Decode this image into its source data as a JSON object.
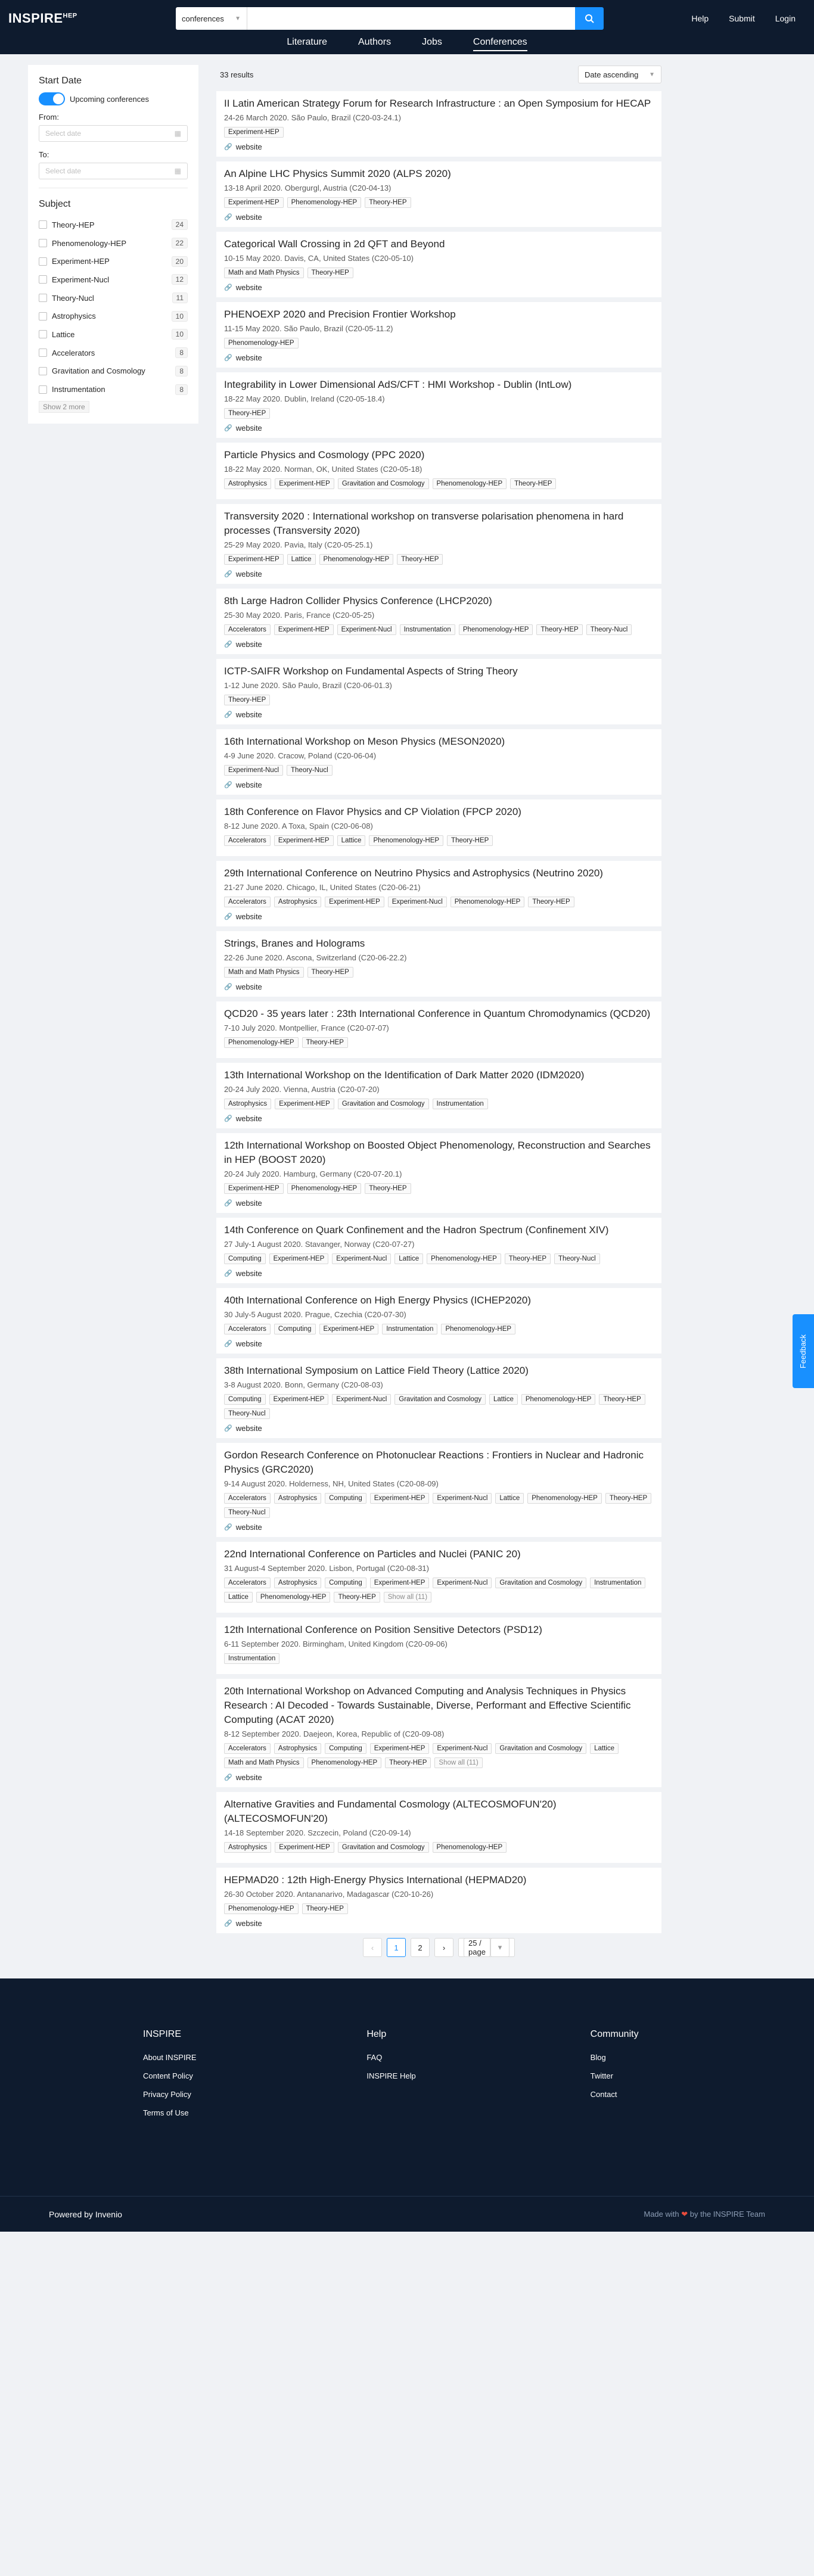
{
  "header": {
    "logo": "INSPIRE",
    "logo_sup": "HEP",
    "search_scope": "conferences",
    "search_value": "",
    "nav": [
      "Help",
      "Submit",
      "Login"
    ],
    "subnav": [
      "Literature",
      "Authors",
      "Jobs",
      "Conferences"
    ],
    "active_subnav": "Conferences"
  },
  "sidebar": {
    "start_date": "Start Date",
    "upcoming": "Upcoming conferences",
    "from": "From:",
    "to": "To:",
    "date_placeholder": "Select date",
    "subject": "Subject",
    "subjects": [
      {
        "label": "Theory-HEP",
        "count": "24"
      },
      {
        "label": "Phenomenology-HEP",
        "count": "22"
      },
      {
        "label": "Experiment-HEP",
        "count": "20"
      },
      {
        "label": "Experiment-Nucl",
        "count": "12"
      },
      {
        "label": "Theory-Nucl",
        "count": "11"
      },
      {
        "label": "Astrophysics",
        "count": "10"
      },
      {
        "label": "Lattice",
        "count": "10"
      },
      {
        "label": "Accelerators",
        "count": "8"
      },
      {
        "label": "Gravitation and Cosmology",
        "count": "8"
      },
      {
        "label": "Instrumentation",
        "count": "8"
      }
    ],
    "show_more": "Show 2 more"
  },
  "results": {
    "count": "33 results",
    "sort": "Date ascending",
    "website_label": "website",
    "items": [
      {
        "title": "II Latin American Strategy Forum for Research Infrastructure : an Open Symposium for HECAP",
        "date": "24-26 March 2020. São Paulo, Brazil (C20-03-24.1)",
        "tags": [
          "Experiment-HEP"
        ],
        "web": true
      },
      {
        "title": "An Alpine LHC Physics Summit 2020 (ALPS 2020)",
        "date": "13-18 April 2020. Obergurgl, Austria (C20-04-13)",
        "tags": [
          "Experiment-HEP",
          "Phenomenology-HEP",
          "Theory-HEP"
        ],
        "web": true
      },
      {
        "title": "Categorical Wall Crossing in 2d QFT and Beyond",
        "date": "10-15 May 2020. Davis, CA, United States (C20-05-10)",
        "tags": [
          "Math and Math Physics",
          "Theory-HEP"
        ],
        "web": true
      },
      {
        "title": "PHENOEXP 2020 and Precision Frontier Workshop",
        "date": "11-15 May 2020. São Paulo, Brazil (C20-05-11.2)",
        "tags": [
          "Phenomenology-HEP"
        ],
        "web": true
      },
      {
        "title": "Integrability in Lower Dimensional AdS/CFT : HMI Workshop - Dublin (IntLow)",
        "date": "18-22 May 2020. Dublin, Ireland (C20-05-18.4)",
        "tags": [
          "Theory-HEP"
        ],
        "web": true
      },
      {
        "title": "Particle Physics and Cosmology (PPC 2020)",
        "date": "18-22 May 2020. Norman, OK, United States (C20-05-18)",
        "tags": [
          "Astrophysics",
          "Experiment-HEP",
          "Gravitation and Cosmology",
          "Phenomenology-HEP",
          "Theory-HEP"
        ],
        "web": false
      },
      {
        "title": "Transversity 2020 : International workshop on transverse polarisation phenomena in hard processes (Transversity 2020)",
        "date": "25-29 May 2020. Pavia, Italy (C20-05-25.1)",
        "tags": [
          "Experiment-HEP",
          "Lattice",
          "Phenomenology-HEP",
          "Theory-HEP"
        ],
        "web": true
      },
      {
        "title": "8th Large Hadron Collider Physics Conference (LHCP2020)",
        "date": "25-30 May 2020. Paris, France (C20-05-25)",
        "tags": [
          "Accelerators",
          "Experiment-HEP",
          "Experiment-Nucl",
          "Instrumentation",
          "Phenomenology-HEP",
          "Theory-HEP",
          "Theory-Nucl"
        ],
        "web": true
      },
      {
        "title": "ICTP-SAIFR Workshop on Fundamental Aspects of String Theory",
        "date": "1-12 June 2020. São Paulo, Brazil (C20-06-01.3)",
        "tags": [
          "Theory-HEP"
        ],
        "web": true
      },
      {
        "title": "16th International Workshop on Meson Physics (MESON2020)",
        "date": "4-9 June 2020. Cracow, Poland (C20-06-04)",
        "tags": [
          "Experiment-Nucl",
          "Theory-Nucl"
        ],
        "web": true
      },
      {
        "title": "18th Conference on Flavor Physics and CP Violation (FPCP 2020)",
        "date": "8-12 June 2020. A Toxa, Spain (C20-06-08)",
        "tags": [
          "Accelerators",
          "Experiment-HEP",
          "Lattice",
          "Phenomenology-HEP",
          "Theory-HEP"
        ],
        "web": false
      },
      {
        "title": "29th International Conference on Neutrino Physics and Astrophysics (Neutrino 2020)",
        "date": "21-27 June 2020. Chicago, IL, United States (C20-06-21)",
        "tags": [
          "Accelerators",
          "Astrophysics",
          "Experiment-HEP",
          "Experiment-Nucl",
          "Phenomenology-HEP",
          "Theory-HEP"
        ],
        "web": true
      },
      {
        "title": "Strings, Branes and Holograms",
        "date": "22-26 June 2020. Ascona, Switzerland (C20-06-22.2)",
        "tags": [
          "Math and Math Physics",
          "Theory-HEP"
        ],
        "web": true
      },
      {
        "title": "QCD20 - 35 years later : 23th International Conference in Quantum Chromodynamics (QCD20)",
        "date": "7-10 July 2020. Montpellier, France (C20-07-07)",
        "tags": [
          "Phenomenology-HEP",
          "Theory-HEP"
        ],
        "web": false
      },
      {
        "title": "13th International Workshop on the Identification of Dark Matter 2020 (IDM2020)",
        "date": "20-24 July 2020. Vienna, Austria (C20-07-20)",
        "tags": [
          "Astrophysics",
          "Experiment-HEP",
          "Gravitation and Cosmology",
          "Instrumentation"
        ],
        "web": true
      },
      {
        "title": "12th International Workshop on Boosted Object Phenomenology, Reconstruction and Searches in HEP (BOOST 2020)",
        "date": "20-24 July 2020. Hamburg, Germany (C20-07-20.1)",
        "tags": [
          "Experiment-HEP",
          "Phenomenology-HEP",
          "Theory-HEP"
        ],
        "web": true
      },
      {
        "title": "14th Conference on Quark Confinement and the Hadron Spectrum (Confinement XIV)",
        "date": "27 July-1 August 2020. Stavanger, Norway (C20-07-27)",
        "tags": [
          "Computing",
          "Experiment-HEP",
          "Experiment-Nucl",
          "Lattice",
          "Phenomenology-HEP",
          "Theory-HEP",
          "Theory-Nucl"
        ],
        "web": true
      },
      {
        "title": "40th International Conference on High Energy Physics (ICHEP2020)",
        "date": "30 July-5 August 2020. Prague, Czechia (C20-07-30)",
        "tags": [
          "Accelerators",
          "Computing",
          "Experiment-HEP",
          "Instrumentation",
          "Phenomenology-HEP"
        ],
        "web": true
      },
      {
        "title": "38th International Symposium on Lattice Field Theory (Lattice 2020)",
        "date": "3-8 August 2020. Bonn, Germany (C20-08-03)",
        "tags": [
          "Computing",
          "Experiment-HEP",
          "Experiment-Nucl",
          "Gravitation and Cosmology",
          "Lattice",
          "Phenomenology-HEP",
          "Theory-HEP",
          "Theory-Nucl"
        ],
        "web": true
      },
      {
        "title": "Gordon Research Conference on Photonuclear Reactions : Frontiers in Nuclear and Hadronic Physics (GRC2020)",
        "date": "9-14 August 2020. Holderness, NH, United States (C20-08-09)",
        "tags": [
          "Accelerators",
          "Astrophysics",
          "Computing",
          "Experiment-HEP",
          "Experiment-Nucl",
          "Lattice",
          "Phenomenology-HEP",
          "Theory-HEP",
          "Theory-Nucl"
        ],
        "web": true
      },
      {
        "title": "22nd International Conference on Particles and Nuclei (PANIC 20)",
        "date": "31 August-4 September 2020. Lisbon, Portugal (C20-08-31)",
        "tags": [
          "Accelerators",
          "Astrophysics",
          "Computing",
          "Experiment-HEP",
          "Experiment-Nucl",
          "Gravitation and Cosmology",
          "Instrumentation",
          "Lattice",
          "Phenomenology-HEP",
          "Theory-HEP"
        ],
        "more": "Show all (11)",
        "web": false
      },
      {
        "title": "12th International Conference on Position Sensitive Detectors (PSD12)",
        "date": "6-11 September 2020. Birmingham, United Kingdom (C20-09-06)",
        "tags": [
          "Instrumentation"
        ],
        "web": false
      },
      {
        "title": "20th International Workshop on Advanced Computing and Analysis Techniques in Physics Research : AI Decoded - Towards Sustainable, Diverse, Performant and Effective Scientific Computing (ACAT 2020)",
        "date": "8-12 September 2020. Daejeon, Korea, Republic of (C20-09-08)",
        "tags": [
          "Accelerators",
          "Astrophysics",
          "Computing",
          "Experiment-HEP",
          "Experiment-Nucl",
          "Gravitation and Cosmology",
          "Lattice",
          "Math and Math Physics",
          "Phenomenology-HEP",
          "Theory-HEP"
        ],
        "more": "Show all (11)",
        "web": true
      },
      {
        "title": "Alternative Gravities and Fundamental Cosmology (ALTECOSMOFUN'20) (ALTECOSMOFUN'20)",
        "date": "14-18 September 2020. Szczecin, Poland (C20-09-14)",
        "tags": [
          "Astrophysics",
          "Experiment-HEP",
          "Gravitation and Cosmology",
          "Phenomenology-HEP"
        ],
        "web": false
      },
      {
        "title": "HEPMAD20 : 12th High-Energy Physics International (HEPMAD20)",
        "date": "26-30 October 2020. Antananarivo, Madagascar (C20-10-26)",
        "tags": [
          "Phenomenology-HEP",
          "Theory-HEP"
        ],
        "web": true
      }
    ]
  },
  "pagination": {
    "prev": "‹",
    "pages": [
      "1",
      "2"
    ],
    "current": "1",
    "next": "›",
    "page_size": "25 / page"
  },
  "footer": {
    "cols": [
      {
        "title": "INSPIRE",
        "links": [
          "About INSPIRE",
          "Content Policy",
          "Privacy Policy",
          "Terms of Use"
        ]
      },
      {
        "title": "Help",
        "links": [
          "FAQ",
          "INSPIRE Help"
        ]
      },
      {
        "title": "Community",
        "links": [
          "Blog",
          "Twitter",
          "Contact"
        ]
      }
    ],
    "powered": "Powered by Invenio",
    "made_pre": "Made with",
    "made_post": "by the INSPIRE Team"
  },
  "feedback": "Feedback"
}
